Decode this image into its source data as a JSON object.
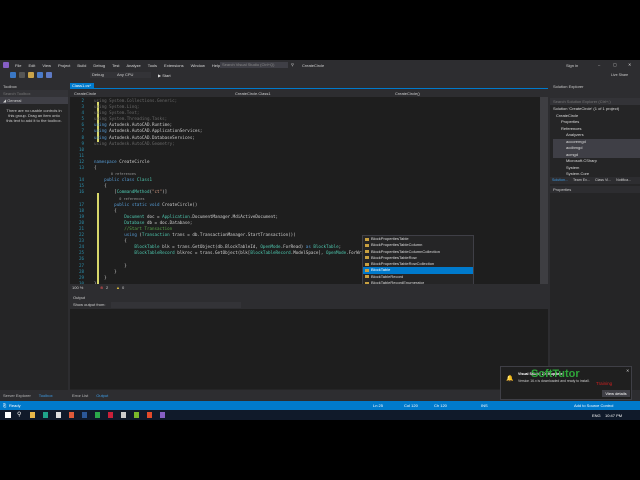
{
  "menu": {
    "items": [
      "File",
      "Edit",
      "View",
      "Project",
      "Build",
      "Debug",
      "Test",
      "Analyze",
      "Tools",
      "Extensions",
      "Window",
      "Help"
    ],
    "search_placeholder": "Search Visual Studio (Ctrl+Q)",
    "solution_name": "CreateCircle",
    "sign_in": "Sign in",
    "live_share": "Live Share"
  },
  "toolbar": {
    "config": "Debug",
    "platform": "Any CPU",
    "start": "▶ Start"
  },
  "toolbox": {
    "title": "Toolbox",
    "search_placeholder": "Search Toolbox",
    "group": "General",
    "empty_text": "There are no usable controls in this group. Drag an item onto this text to add it to the toolbox."
  },
  "editor": {
    "tab": "Class1.cs*",
    "nav_project": "CreateCircle",
    "nav_class": "CreateCircle.Class1",
    "nav_member": "CreateCircle()",
    "zoom": "100 %",
    "errors": "2",
    "warnings": "0",
    "lines": [
      {
        "n": "2",
        "t": [
          [
            "using System.Collections.Generic;",
            "dim"
          ]
        ]
      },
      {
        "n": "3",
        "t": [
          [
            "using System.Linq;",
            "dim"
          ]
        ]
      },
      {
        "n": "4",
        "t": [
          [
            "using System.Text;",
            "dim"
          ]
        ]
      },
      {
        "n": "5",
        "t": [
          [
            "using System.Threading.Tasks;",
            "dim"
          ]
        ]
      },
      {
        "n": "6",
        "t": [
          [
            "using ",
            "kw"
          ],
          [
            "Autodesk.AutoCAD.Runtime;",
            ""
          ]
        ]
      },
      {
        "n": "7",
        "t": [
          [
            "using ",
            "kw"
          ],
          [
            "Autodesk.AutoCAD.ApplicationServices;",
            ""
          ]
        ]
      },
      {
        "n": "8",
        "t": [
          [
            "using ",
            "kw"
          ],
          [
            "Autodesk.AutoCAD.DatabaseServices;",
            ""
          ]
        ]
      },
      {
        "n": "9",
        "t": [
          [
            "using Autodesk.AutoCAD.Geometry;",
            "dim"
          ]
        ]
      },
      {
        "n": "10",
        "t": []
      },
      {
        "n": "11",
        "t": []
      },
      {
        "n": "12",
        "t": [
          [
            "namespace ",
            "kw"
          ],
          [
            "CreateCircle",
            ""
          ]
        ]
      },
      {
        "n": "13",
        "t": [
          [
            "{",
            ""
          ]
        ]
      },
      {
        "n": "",
        "t": [
          [
            "        0 references",
            "ref"
          ]
        ]
      },
      {
        "n": "14",
        "t": [
          [
            "    public class ",
            "kw"
          ],
          [
            "Class1",
            "ty"
          ]
        ]
      },
      {
        "n": "15",
        "t": [
          [
            "    {",
            ""
          ]
        ]
      },
      {
        "n": "16",
        "t": [
          [
            "        [",
            ""
          ],
          [
            "CommandMethod",
            "ty"
          ],
          [
            "(",
            ""
          ],
          [
            "\"ct\"",
            "st"
          ],
          [
            ")]",
            ""
          ]
        ]
      },
      {
        "n": "",
        "t": [
          [
            "            0 references",
            "ref"
          ]
        ]
      },
      {
        "n": "17",
        "t": [
          [
            "        public static void ",
            "kw"
          ],
          [
            "CreateCircle()",
            ""
          ]
        ]
      },
      {
        "n": "18",
        "t": [
          [
            "        {",
            ""
          ]
        ]
      },
      {
        "n": "19",
        "t": [
          [
            "            ",
            ""
          ],
          [
            "Document",
            "ty"
          ],
          [
            " doc = ",
            ""
          ],
          [
            "Application",
            "ty"
          ],
          [
            ".DocumentManager.MdiActiveDocument;",
            ""
          ]
        ]
      },
      {
        "n": "20",
        "t": [
          [
            "            ",
            ""
          ],
          [
            "Database",
            "ty"
          ],
          [
            " db = doc.Database;",
            ""
          ]
        ]
      },
      {
        "n": "21",
        "t": [
          [
            "            //Start Transaction",
            "cm"
          ]
        ]
      },
      {
        "n": "22",
        "t": [
          [
            "            using ",
            "kw"
          ],
          [
            "(",
            ""
          ],
          [
            "Transaction",
            "ty"
          ],
          [
            " trans = db.TransactionManager.StartTransaction())",
            ""
          ]
        ]
      },
      {
        "n": "23",
        "t": [
          [
            "            {",
            ""
          ]
        ]
      },
      {
        "n": "24",
        "t": [
          [
            "                ",
            ""
          ],
          [
            "BlockTable",
            "ty"
          ],
          [
            " blk = trans.GetObject(db.BlockTableId, ",
            ""
          ],
          [
            "OpenMode",
            "ty"
          ],
          [
            ".ForRead) ",
            ""
          ],
          [
            "as ",
            "kw"
          ],
          [
            "BlockTable",
            "ty"
          ],
          [
            ";",
            ""
          ]
        ]
      },
      {
        "n": "25",
        "t": [
          [
            "                ",
            ""
          ],
          [
            "BlockTableRecord",
            "ty"
          ],
          [
            " blkrec = trans.GetObject(blk[",
            ""
          ],
          [
            "BlockTableRecord",
            "ty"
          ],
          [
            ".ModelSpace], ",
            ""
          ],
          [
            "OpenMode",
            "ty"
          ],
          [
            ".ForWrite) ",
            ""
          ],
          [
            "as ",
            "kw"
          ],
          [
            "BlockTa",
            ""
          ]
        ]
      },
      {
        "n": "26",
        "t": [
          [
            "                ",
            ""
          ]
        ]
      },
      {
        "n": "27",
        "t": [
          [
            "            }",
            ""
          ]
        ]
      },
      {
        "n": "28",
        "t": [
          [
            "        }",
            ""
          ]
        ]
      },
      {
        "n": "29",
        "t": [
          [
            "    }",
            ""
          ]
        ]
      },
      {
        "n": "30",
        "t": [
          [
            "}",
            ""
          ]
        ]
      }
    ]
  },
  "autocomplete": {
    "items": [
      "BlockPropertiesTable",
      "BlockPropertiesTableColumn",
      "BlockPropertiesTableColumnCollection",
      "BlockPropertiesTableRow",
      "BlockPropertiesTableRowCollection",
      "BlockTable",
      "BlockTableRecord",
      "BlockTableRecordEnumerator"
    ],
    "selected_index": 5
  },
  "output": {
    "title": "Output",
    "show_from": "Show output from:"
  },
  "bottom_tabs": {
    "left": [
      "Server Explorer",
      "Toolbox"
    ],
    "mid": [
      "Error List",
      "Output"
    ]
  },
  "solution_explorer": {
    "title": "Solution Explorer",
    "search_placeholder": "Search Solution Explorer (Ctrl+;)",
    "tree": [
      "Solution 'CreateCircle' (1 of 1 project)",
      "CreateCircle",
      "Properties",
      "References",
      "Analyzers",
      "accoremgd",
      "acdbmgd",
      "acmgd",
      "Microsoft.CSharp",
      "System",
      "System.Core"
    ],
    "tabs": [
      "Solution...",
      "Team Ex...",
      "Class Vi...",
      "Notifica..."
    ],
    "properties_title": "Properties"
  },
  "notification": {
    "title": "Visual Studio 2019 update",
    "body": "Version 16.x is downloaded and ready to install.",
    "button": "View details",
    "watermark": "SoftTutor Training"
  },
  "status": {
    "ready": "Ready",
    "ln": "Ln 25",
    "col": "Col 120",
    "ch": "Ch 120",
    "ins": "INS",
    "source_control": "Add to Source Control"
  },
  "taskbar": {
    "lang": "ENG",
    "time": "10:47 PM"
  },
  "colors": {
    "accent": "#007acc",
    "editor_bg": "#1e1e1e"
  }
}
